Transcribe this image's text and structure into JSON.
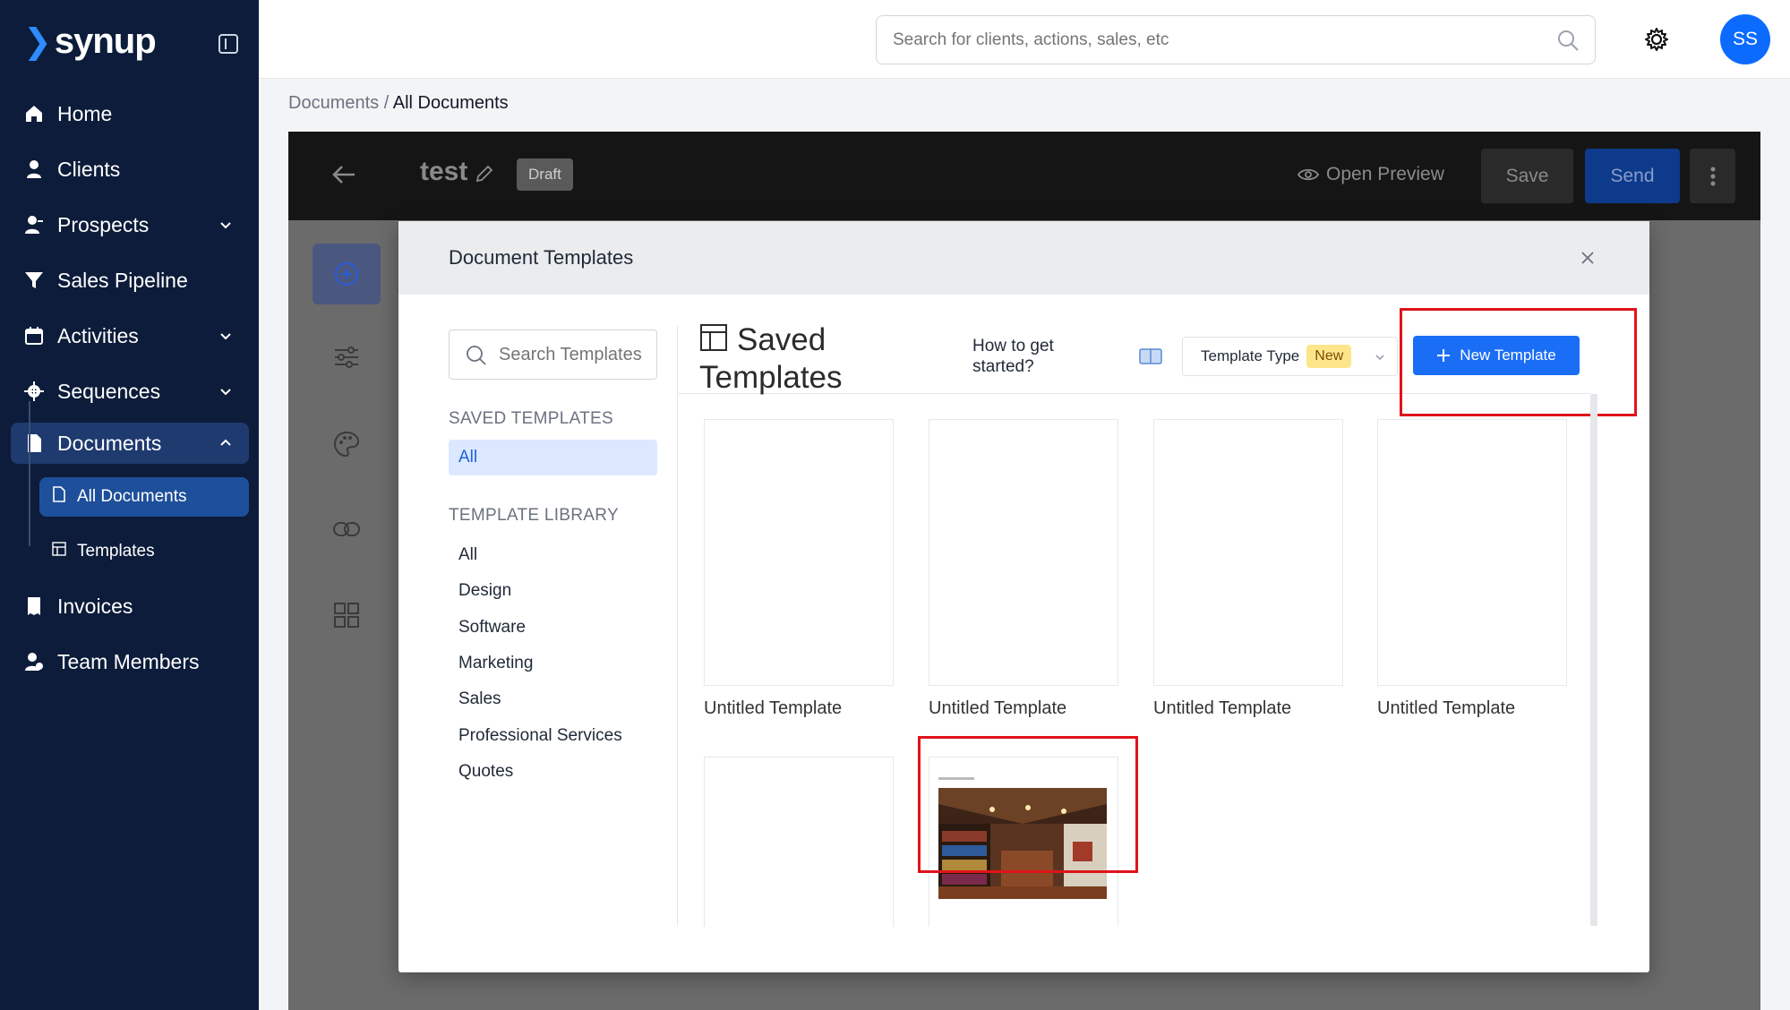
{
  "sidebar": {
    "logo": "synup",
    "items": [
      {
        "label": "Home",
        "icon": "home-icon"
      },
      {
        "label": "Clients",
        "icon": "user-icon"
      },
      {
        "label": "Prospects",
        "icon": "user-plus-icon"
      },
      {
        "label": "Sales Pipeline",
        "icon": "funnel-icon"
      },
      {
        "label": "Activities",
        "icon": "calendar-icon"
      },
      {
        "label": "Sequences",
        "icon": "gear-icon"
      },
      {
        "label": "Documents",
        "icon": "document-icon"
      },
      {
        "label": "Invoices",
        "icon": "receipt-icon"
      },
      {
        "label": "Team Members",
        "icon": "team-icon"
      }
    ],
    "sub_items": [
      {
        "label": "All Documents",
        "icon": "file-icon"
      },
      {
        "label": "Templates",
        "icon": "template-icon"
      }
    ]
  },
  "topbar": {
    "search_placeholder": "Search for clients, actions, sales, etc",
    "avatar_initials": "SS"
  },
  "breadcrumb": {
    "parent": "Documents",
    "separator": " / ",
    "current": "All Documents"
  },
  "editor": {
    "doc_title": "test",
    "status": "Draft",
    "open_preview": "Open Preview",
    "save_label": "Save",
    "send_label": "Send"
  },
  "modal": {
    "title": "Document Templates",
    "search_placeholder": "Search Templates",
    "saved_section": "SAVED TEMPLATES",
    "saved_all": "All",
    "library_section": "TEMPLATE LIBRARY",
    "library_items": [
      "All",
      "Design",
      "Software",
      "Marketing",
      "Sales",
      "Professional Services",
      "Quotes"
    ],
    "heading": "Saved Templates",
    "how_to": "How to get started?",
    "template_type": "Template Type",
    "new_badge": "New",
    "new_template_button": "New Template",
    "cards": [
      {
        "label": "Untitled Template"
      },
      {
        "label": "Untitled Template"
      },
      {
        "label": "Untitled Template"
      },
      {
        "label": "Untitled Template"
      }
    ]
  },
  "colors": {
    "sidebar_bg": "#0c1c3a",
    "accent_blue": "#1a6ef5",
    "highlight_red": "#e0131a"
  }
}
